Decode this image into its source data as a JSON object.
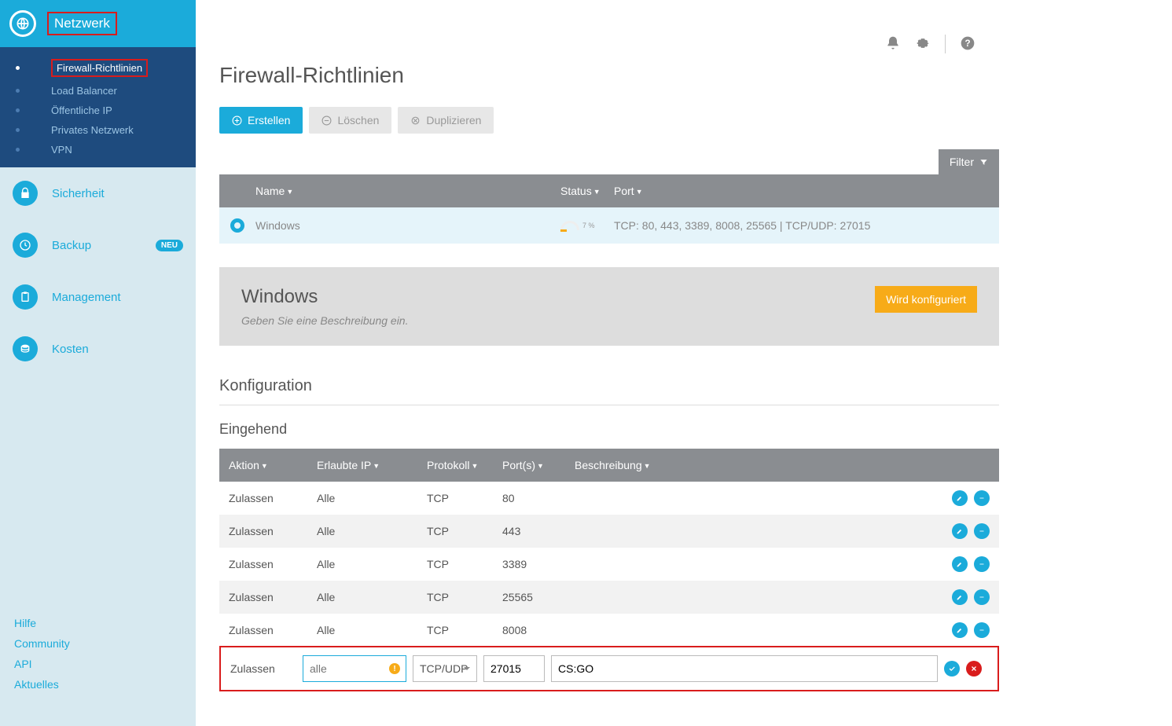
{
  "sidebar": {
    "top_label": "Netzwerk",
    "subnav": [
      {
        "label": "Firewall-Richtlinien",
        "active": true
      },
      {
        "label": "Load Balancer"
      },
      {
        "label": "Öffentliche IP"
      },
      {
        "label": "Privates Netzwerk"
      },
      {
        "label": "VPN"
      }
    ],
    "sections": [
      {
        "label": "Sicherheit",
        "icon": "lock"
      },
      {
        "label": "Backup",
        "icon": "clock",
        "badge": "NEU"
      },
      {
        "label": "Management",
        "icon": "clipboard"
      },
      {
        "label": "Kosten",
        "icon": "coins"
      }
    ],
    "footer": [
      "Hilfe",
      "Community",
      "API",
      "Aktuelles"
    ]
  },
  "page_title": "Firewall-Richtlinien",
  "actions": {
    "create": "Erstellen",
    "delete": "Löschen",
    "duplicate": "Duplizieren"
  },
  "filter_label": "Filter",
  "list_headers": {
    "name": "Name",
    "status": "Status",
    "port": "Port"
  },
  "policy": {
    "name": "Windows",
    "status_pct": "7 %",
    "port": "TCP: 80, 443, 3389, 8008, 25565 | TCP/UDP: 27015"
  },
  "detail": {
    "title": "Windows",
    "description_placeholder": "Geben Sie eine Beschreibung ein.",
    "status_btn": "Wird konfiguriert"
  },
  "config_title": "Konfiguration",
  "ingoing_title": "Eingehend",
  "rule_headers": {
    "aktion": "Aktion",
    "ip": "Erlaubte IP",
    "protokoll": "Protokoll",
    "ports": "Port(s)",
    "beschreibung": "Beschreibung"
  },
  "rules": [
    {
      "aktion": "Zulassen",
      "ip": "Alle",
      "proto": "TCP",
      "port": "80",
      "desc": ""
    },
    {
      "aktion": "Zulassen",
      "ip": "Alle",
      "proto": "TCP",
      "port": "443",
      "desc": ""
    },
    {
      "aktion": "Zulassen",
      "ip": "Alle",
      "proto": "TCP",
      "port": "3389",
      "desc": ""
    },
    {
      "aktion": "Zulassen",
      "ip": "Alle",
      "proto": "TCP",
      "port": "25565",
      "desc": ""
    },
    {
      "aktion": "Zulassen",
      "ip": "Alle",
      "proto": "TCP",
      "port": "8008",
      "desc": ""
    }
  ],
  "new_rule": {
    "aktion": "Zulassen",
    "ip_placeholder": "alle",
    "proto": "TCP/UDP",
    "port": "27015",
    "desc": "CS:GO"
  }
}
